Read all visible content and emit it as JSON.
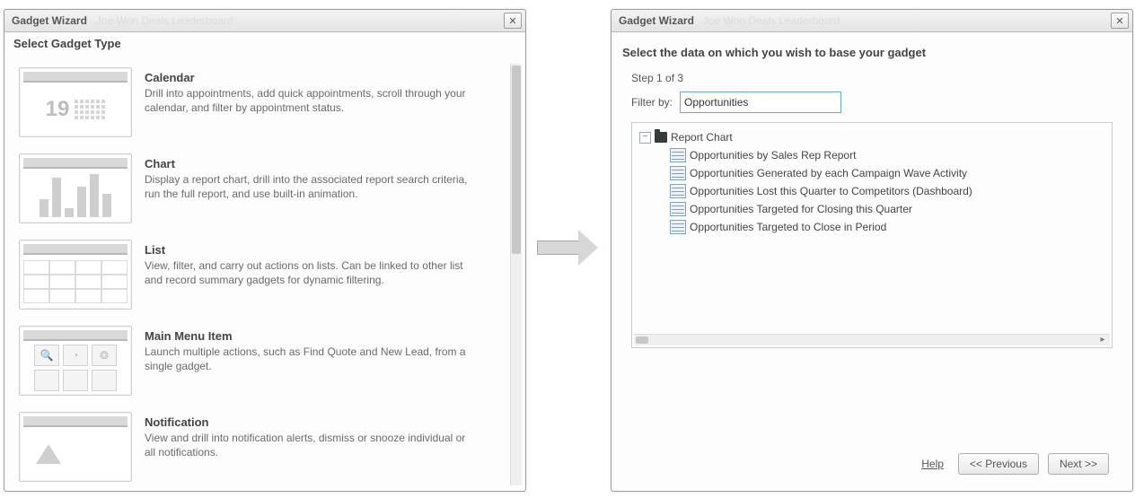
{
  "left": {
    "title": "Gadget Wizard",
    "bg_text": "Joe   Won Deals Leaderboard",
    "heading": "Select Gadget Type",
    "items": [
      {
        "title": "Calendar",
        "desc": "Drill into appointments, add quick appointments, scroll through your calendar, and filter by appointment status."
      },
      {
        "title": "Chart",
        "desc": "Display a report chart, drill into the associated report search criteria, run the full report, and use built-in animation."
      },
      {
        "title": "List",
        "desc": "View, filter, and carry out actions on lists. Can be linked to other list and record summary gadgets for dynamic filtering."
      },
      {
        "title": "Main Menu Item",
        "desc": "Launch multiple actions, such as Find Quote and New Lead, from a single gadget."
      },
      {
        "title": "Notification",
        "desc": "View and drill into notification alerts, dismiss or snooze individual or all notifications."
      }
    ]
  },
  "right": {
    "title": "Gadget Wizard",
    "bg_text": "Joe   Won Deals Leaderboard",
    "heading": "Select the data on which you wish to base your gadget",
    "step": "Step 1 of 3",
    "filter_label": "Filter by:",
    "filter_value": "Opportunities",
    "tree_root": "Report Chart",
    "tree_children": [
      "Opportunities by Sales Rep Report",
      "Opportunities Generated by each Campaign Wave Activity",
      "Opportunities Lost this Quarter to Competitors (Dashboard)",
      "Opportunities Targeted for Closing this Quarter",
      "Opportunities Targeted to Close in Period"
    ],
    "help": "Help",
    "prev": "<< Previous",
    "next": "Next >>"
  },
  "glyphs": {
    "close": "✕",
    "minus": "−",
    "right": "▸",
    "mag": "🔍",
    "pie": "◔",
    "globe": "❂"
  }
}
